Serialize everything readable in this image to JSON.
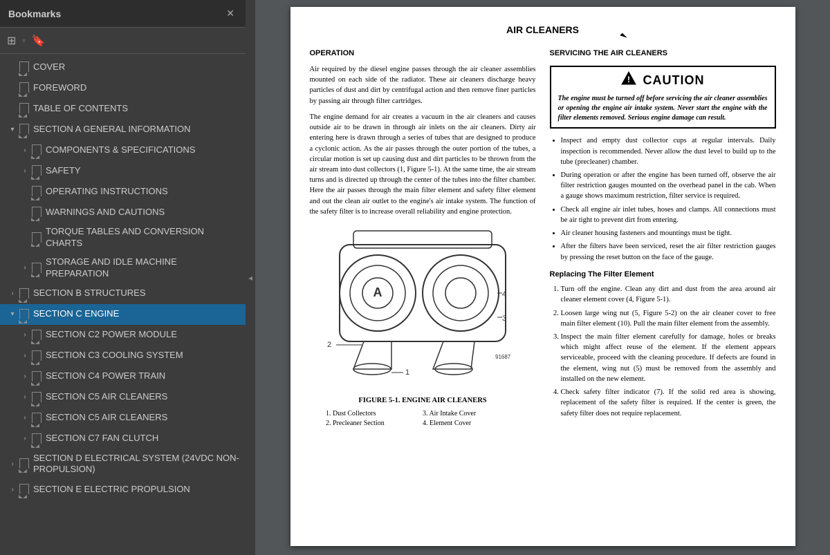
{
  "sidebar": {
    "title": "Bookmarks",
    "items": [
      {
        "id": "cover",
        "label": "COVER",
        "level": 1,
        "expandable": false,
        "expanded": false
      },
      {
        "id": "foreword",
        "label": "FOREWORD",
        "level": 1,
        "expandable": false,
        "expanded": false
      },
      {
        "id": "toc",
        "label": "TABLE OF CONTENTS",
        "level": 1,
        "expandable": false,
        "expanded": false
      },
      {
        "id": "section-a",
        "label": "SECTION A GENERAL INFORMATION",
        "level": 1,
        "expandable": true,
        "expanded": true
      },
      {
        "id": "comp-specs",
        "label": "COMPONENTS & SPECIFICATIONS",
        "level": 2,
        "expandable": true,
        "expanded": false
      },
      {
        "id": "safety",
        "label": "SAFETY",
        "level": 2,
        "expandable": false,
        "expanded": false
      },
      {
        "id": "operating",
        "label": "OPERATING INSTRUCTIONS",
        "level": 2,
        "expandable": false,
        "expanded": false
      },
      {
        "id": "warnings",
        "label": "WARNINGS AND CAUTIONS",
        "level": 2,
        "expandable": false,
        "expanded": false
      },
      {
        "id": "torque",
        "label": "TORQUE TABLES AND CONVERSION CHARTS",
        "level": 2,
        "expandable": false,
        "expanded": false,
        "noExpand": true
      },
      {
        "id": "storage",
        "label": "STORAGE AND IDLE MACHINE PREPARATION",
        "level": 2,
        "expandable": true,
        "expanded": false
      },
      {
        "id": "section-b",
        "label": "SECTION B STRUCTURES",
        "level": 1,
        "expandable": true,
        "expanded": false
      },
      {
        "id": "section-c",
        "label": "SECTION C ENGINE",
        "level": 1,
        "expandable": true,
        "expanded": true,
        "selected": true
      },
      {
        "id": "section-c2",
        "label": "SECTION C2 POWER MODULE",
        "level": 2,
        "expandable": true,
        "expanded": false
      },
      {
        "id": "section-c3",
        "label": "SECTION C3 COOLING SYSTEM",
        "level": 2,
        "expandable": true,
        "expanded": false
      },
      {
        "id": "section-c4",
        "label": "SECTION C4 POWER TRAIN",
        "level": 2,
        "expandable": true,
        "expanded": false
      },
      {
        "id": "section-c5a",
        "label": "SECTION C5 AIR CLEANERS",
        "level": 2,
        "expandable": true,
        "expanded": false
      },
      {
        "id": "section-c5b",
        "label": "SECTION C5 AIR CLEANERS",
        "level": 2,
        "expandable": true,
        "expanded": false
      },
      {
        "id": "section-c7",
        "label": "SECTION C7 FAN CLUTCH",
        "level": 2,
        "expandable": true,
        "expanded": false
      },
      {
        "id": "section-d",
        "label": "SECTION D ELECTRICAL SYSTEM (24VDC NON-PROPULSION)",
        "level": 1,
        "expandable": true,
        "expanded": false
      },
      {
        "id": "section-e",
        "label": "SECTION E ELECTRIC PROPULSION",
        "level": 1,
        "expandable": true,
        "expanded": false
      }
    ]
  },
  "document": {
    "title": "AIR CLEANERS",
    "left_col": {
      "heading": "OPERATION",
      "paragraphs": [
        "Air required by the diesel engine passes through the air cleaner assemblies mounted on each side of the radiator. These air cleaners discharge heavy particles of dust and dirt by centrifugal action and then remove finer particles by passing air through filter cartridges.",
        "The engine demand for air creates a vacuum in the air cleaners and causes outside air to be drawn in through air inlets on the air cleaners. Dirty air entering here is drawn through a series of tubes that are designed to produce a cyclonic action. As the air passes through the outer portion of the tubes, a circular motion is set up causing dust and dirt particles to be thrown from the air stream into dust collectors (1, Figure 5-1). At the same time, the air stream turns and is directed up through the center of the tubes into the filter chamber. Here the air passes through the main filter element and safety filter element and out the clean air outlet to the engine's air intake system. The function of the safety filter is to increase overall reliability and engine protection."
      ],
      "figure_caption": "FIGURE 5-1. ENGINE AIR CLEANERS",
      "figure_labels": [
        "1. Dust Collectors",
        "3. Air Intake Cover",
        "2. Precleaner Section",
        "4. Element Cover"
      ]
    },
    "right_col": {
      "heading": "SERVICING THE AIR CLEANERS",
      "caution_title": "CAUTION",
      "caution_text": "The engine must be turned off before servicing the air cleaner assemblies or opening the engine air intake system. Never start the engine with the filter elements removed. Serious engine damage can result.",
      "bullets": [
        "Inspect and empty dust collector cups at regular intervals. Daily inspection is recommended. Never allow the dust level to build up to the tube (precleaner) chamber.",
        "During operation or after the engine has been turned off, observe the air filter restriction gauges mounted on the overhead panel in the cab. When a gauge shows maximum restriction, filter service is required.",
        "Check all engine air inlet tubes, hoses and clamps. All connections must be air tight to prevent dirt from entering.",
        "Air cleaner housing fasteners and mountings must be tight.",
        "After the filters have been serviced, reset the air filter restriction gauges by pressing the reset button on the face of the gauge."
      ],
      "replace_heading": "Replacing The Filter Element",
      "steps": [
        "Turn off the engine. Clean any dirt and dust from the area around air cleaner element cover (4, Figure 5-1).",
        "Loosen large wing nut (5, Figure 5-2) on the air cleaner cover to free main filter element (10). Pull the main filter element from the assembly.",
        "Inspect the main filter element carefully for damage, holes or breaks which might affect reuse of the element. If the element appears serviceable, proceed with the cleaning procedure. If defects are found in the element, wing nut (5) must be removed from the assembly and installed on the new element.",
        "Check safety filter indicator (7). If the solid red area is showing, replacement of the safety filter is required. If the center is green, the safety filter does not require replacement."
      ]
    }
  }
}
